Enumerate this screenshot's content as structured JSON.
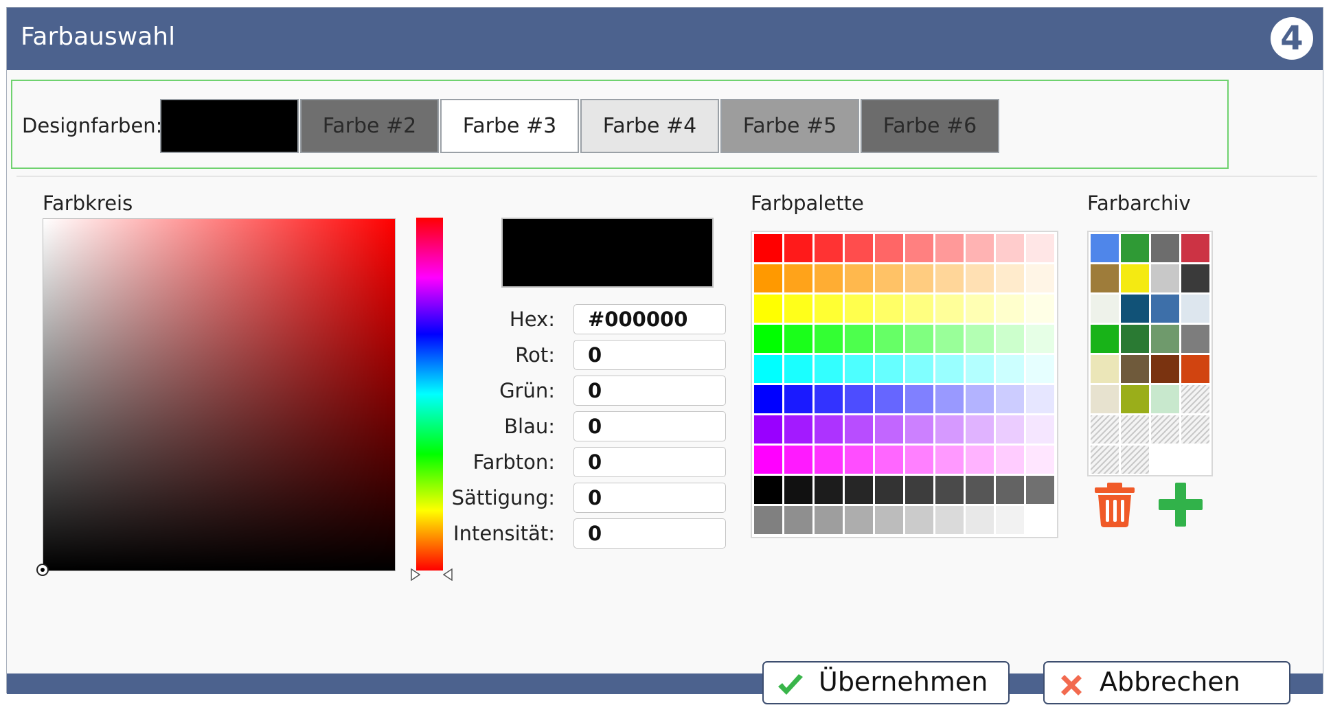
{
  "dialog": {
    "title": "Farbauswahl",
    "logo_text": "4"
  },
  "design_colors": {
    "label": "Designfarben:",
    "swatches": [
      {
        "label": "",
        "bg": "#000000",
        "fg": "#ffffff"
      },
      {
        "label": "Farbe #2",
        "bg": "#6f6f6f",
        "fg": "#2a2a2a"
      },
      {
        "label": "Farbe #3",
        "bg": "#ffffff",
        "fg": "#222222"
      },
      {
        "label": "Farbe #4",
        "bg": "#e6e6e6",
        "fg": "#222222"
      },
      {
        "label": "Farbe #5",
        "bg": "#9d9d9d",
        "fg": "#2a2a2a"
      },
      {
        "label": "Farbe #6",
        "bg": "#6c6c6c",
        "fg": "#2a2a2a"
      }
    ]
  },
  "color_wheel": {
    "label": "Farbkreis"
  },
  "preview": {
    "color": "#000000"
  },
  "fields": {
    "hex": {
      "label": "Hex:",
      "value": "#000000"
    },
    "rot": {
      "label": "Rot:",
      "value": "0"
    },
    "gruen": {
      "label": "Grün:",
      "value": "0"
    },
    "blau": {
      "label": "Blau:",
      "value": "0"
    },
    "farbton": {
      "label": "Farbton:",
      "value": "0"
    },
    "saettigung": {
      "label": "Sättigung:",
      "value": "0"
    },
    "intensitaet": {
      "label": "Intensität:",
      "value": "0"
    }
  },
  "palette": {
    "label": "Farbpalette",
    "colors": [
      "#ff0000",
      "#ff1a1a",
      "#ff3333",
      "#ff4d4d",
      "#ff6666",
      "#ff8080",
      "#ff9999",
      "#ffb3b3",
      "#ffcccc",
      "#ffe6e6",
      "#ff9900",
      "#ffa31a",
      "#ffad33",
      "#ffb84d",
      "#ffc266",
      "#ffcc80",
      "#ffd699",
      "#ffe0b3",
      "#ffebcc",
      "#fff5e6",
      "#ffff00",
      "#ffff1a",
      "#ffff33",
      "#ffff4d",
      "#ffff66",
      "#ffff80",
      "#ffff99",
      "#ffffb3",
      "#ffffcc",
      "#ffffe6",
      "#00ff00",
      "#1aff1a",
      "#33ff33",
      "#4dff4d",
      "#66ff66",
      "#80ff80",
      "#99ff99",
      "#b3ffb3",
      "#ccffcc",
      "#e6ffe6",
      "#00ffff",
      "#1affff",
      "#33ffff",
      "#4dffff",
      "#66ffff",
      "#80ffff",
      "#99ffff",
      "#b3ffff",
      "#ccffff",
      "#e6ffff",
      "#0000ff",
      "#1a1aff",
      "#3333ff",
      "#4d4dff",
      "#6666ff",
      "#8080ff",
      "#9999ff",
      "#b3b3ff",
      "#ccccff",
      "#e6e6ff",
      "#9900ff",
      "#a31aff",
      "#ad33ff",
      "#b84dff",
      "#c266ff",
      "#cc80ff",
      "#d699ff",
      "#e0b3ff",
      "#ebccff",
      "#f5e6ff",
      "#ff00ff",
      "#ff1aff",
      "#ff33ff",
      "#ff4dff",
      "#ff66ff",
      "#ff80ff",
      "#ff99ff",
      "#ffb3ff",
      "#ffccff",
      "#ffe6ff",
      "#000000",
      "#111111",
      "#1c1c1c",
      "#262626",
      "#333333",
      "#3d3d3d",
      "#4a4a4a",
      "#565656",
      "#636363",
      "#707070",
      "#808080",
      "#8f8f8f",
      "#9e9e9e",
      "#adadad",
      "#bcbcbc",
      "#cbcbcb",
      "#dadada",
      "#e8e8e8",
      "#f2f2f2",
      "#ffffff"
    ]
  },
  "archive": {
    "label": "Farbarchiv",
    "colors": [
      "#4f86ea",
      "#2f9a35",
      "#6d6d6d",
      "#cc3344",
      "#9e7c3a",
      "#f4ea12",
      "#c8c8c8",
      "#3a3a3a",
      "#eef2ea",
      "#115277",
      "#3d6fa9",
      "#dde6ee",
      "#18b318",
      "#2a7a33",
      "#6f9a6c",
      "#7d7d7d",
      "#ebe6b8",
      "#6f5a3b",
      "#7a3310",
      "#d14410",
      "#e7e2cf",
      "#9aae1a",
      "#c8e8cd",
      "empty",
      "empty",
      "empty",
      "empty",
      "empty",
      "empty",
      "empty",
      "blank",
      "blank"
    ],
    "trash_color": "#f05a28",
    "add_color": "#31b24a"
  },
  "actions": {
    "apply_label": "Übernehmen",
    "cancel_label": "Abbrechen",
    "apply_icon_color": "#39b54a",
    "cancel_icon_color": "#f26a4f"
  }
}
